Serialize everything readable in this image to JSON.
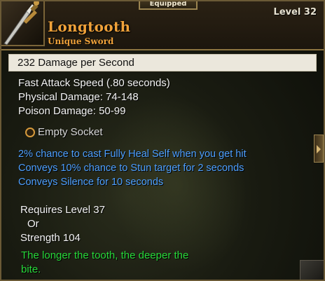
{
  "header": {
    "equipped_label": "Equipped",
    "name": "Longtooth",
    "type": "Unique Sword",
    "level": "Level 32",
    "item_icon": "sword-icon"
  },
  "stats": {
    "dps": "232  Damage per Second",
    "attack_speed": "Fast Attack Speed (.80 seconds)",
    "physical": "Physical Damage: 74-148",
    "poison": "Poison Damage: 50-99"
  },
  "socket": {
    "label": "Empty Socket",
    "icon": "socket-ring-icon"
  },
  "affixes": [
    "2% chance to cast Fully Heal Self when you get hit",
    "Conveys 10% chance to Stun target for 2 seconds",
    "Conveys Silence for 10 seconds"
  ],
  "requirements": {
    "level": "Requires Level 37",
    "or": "Or",
    "strength": "Strength 104"
  },
  "flavor": {
    "line1": "The longer the tooth, the deeper the",
    "line2": "bite."
  },
  "colors": {
    "name": "#f0a23a",
    "affix": "#4d9fff",
    "flavor": "#28d83a",
    "border": "#8c7440"
  }
}
